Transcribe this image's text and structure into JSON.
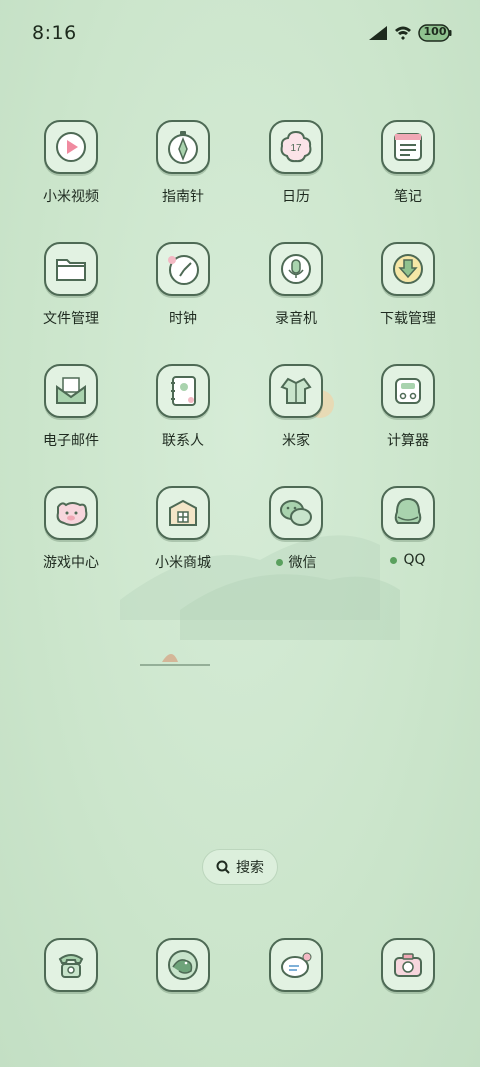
{
  "status_bar": {
    "time": "8:16",
    "battery_level": "100"
  },
  "apps": [
    {
      "label": "小米视频",
      "icon": "video-icon"
    },
    {
      "label": "指南针",
      "icon": "compass-icon"
    },
    {
      "label": "日历",
      "icon": "calendar-icon",
      "date": "17"
    },
    {
      "label": "笔记",
      "icon": "notes-icon"
    },
    {
      "label": "文件管理",
      "icon": "folder-icon"
    },
    {
      "label": "时钟",
      "icon": "clock-icon"
    },
    {
      "label": "录音机",
      "icon": "microphone-icon"
    },
    {
      "label": "下载管理",
      "icon": "download-icon"
    },
    {
      "label": "电子邮件",
      "icon": "mail-icon"
    },
    {
      "label": "联系人",
      "icon": "contacts-icon"
    },
    {
      "label": "米家",
      "icon": "mijia-icon"
    },
    {
      "label": "计算器",
      "icon": "calculator-icon"
    },
    {
      "label": "游戏中心",
      "icon": "game-icon"
    },
    {
      "label": "小米商城",
      "icon": "store-icon"
    },
    {
      "label": "微信",
      "icon": "wechat-icon",
      "new": true
    },
    {
      "label": "QQ",
      "icon": "qq-icon",
      "new": true
    }
  ],
  "search": {
    "label": "搜索"
  },
  "dock": [
    {
      "icon": "phone-icon"
    },
    {
      "icon": "browser-icon"
    },
    {
      "icon": "messages-icon"
    },
    {
      "icon": "camera-icon"
    }
  ],
  "colors": {
    "background": "#cfe6cf",
    "icon_border": "#4e6a55",
    "icon_fill": "#e2f2e2",
    "new_dot": "#5aa05e"
  }
}
